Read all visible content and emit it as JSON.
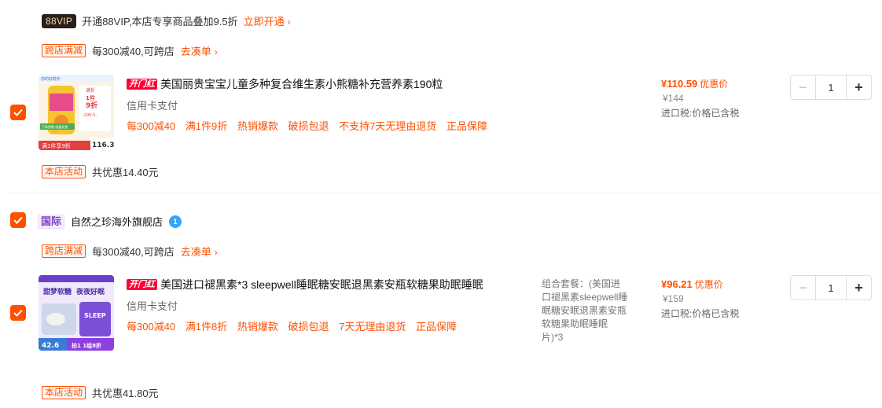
{
  "vip": {
    "badge": "88VIP",
    "text": "开通88VIP,本店专享商品叠加9.5折",
    "link": "立即开通"
  },
  "store1": {
    "cross_tag": "跨店满减",
    "cross_text": "每300减40,可跨店",
    "cross_link": "去凑单",
    "item": {
      "badge": "开门红",
      "title": "美国丽贵宝宝儿童多种复合维生素小熊糖补充营养素190粒",
      "pay": "信用卡支付",
      "promos": [
        "每300减40",
        "满1件9折",
        "热销爆款",
        "破损包退",
        "不支持7天无理由退货",
        "正品保障"
      ],
      "price_now": "¥110.59",
      "price_label": "优惠价",
      "price_old": "¥144",
      "tax": "进口税:价格已含税",
      "qty": "1",
      "minus": "−",
      "plus": "+",
      "thumb": {
        "top": "你的好帮手",
        "promo1": "满折",
        "promo2": "1件",
        "promo3": "9折",
        "promo4": "-299-5-",
        "promo5": "下单即赠 限量发售",
        "bottom": "满1件享9折",
        "price": "116.3"
      }
    },
    "activity_tag": "本店活动",
    "activity_text": "共优惠14.40元"
  },
  "store2": {
    "intl_badge": "国际",
    "name": "自然之珍海外旗舰店",
    "icon_text": "1",
    "cross_tag": "跨店满减",
    "cross_text": "每300减40,可跨店",
    "cross_link": "去凑单",
    "item": {
      "badge": "开门红",
      "title": "美国进口褪黑素*3 sleepwell睡眠糖安眠退黑素安瓶软糖果助眠睡眠",
      "pay": "信用卡支付",
      "promos": [
        "每300减40",
        "满1件8折",
        "热销爆款",
        "破损包退",
        "7天无理由退货",
        "正品保障"
      ],
      "combo": "组合套餐：(美国进口褪黑素sleepwell睡眠糖安眠退黑素安瓶软糖果助眠睡眠片)*3",
      "price_now": "¥96.21",
      "price_label": "优惠价",
      "price_old": "¥159",
      "tax": "进口税:价格已含税",
      "qty": "1",
      "minus": "−",
      "plus": "+",
      "thumb": {
        "head1": "甜梦软糖",
        "head2": "夜夜好眠",
        "brand": "SLEEP",
        "price": "42.6",
        "deal": "拍1 1组8折"
      }
    },
    "activity_tag": "本店活动",
    "activity_text": "共优惠41.80元"
  },
  "colors": {
    "accent": "#ff5000",
    "badge_red": "#ff0036",
    "intl_purple": "#7a3cc4"
  }
}
